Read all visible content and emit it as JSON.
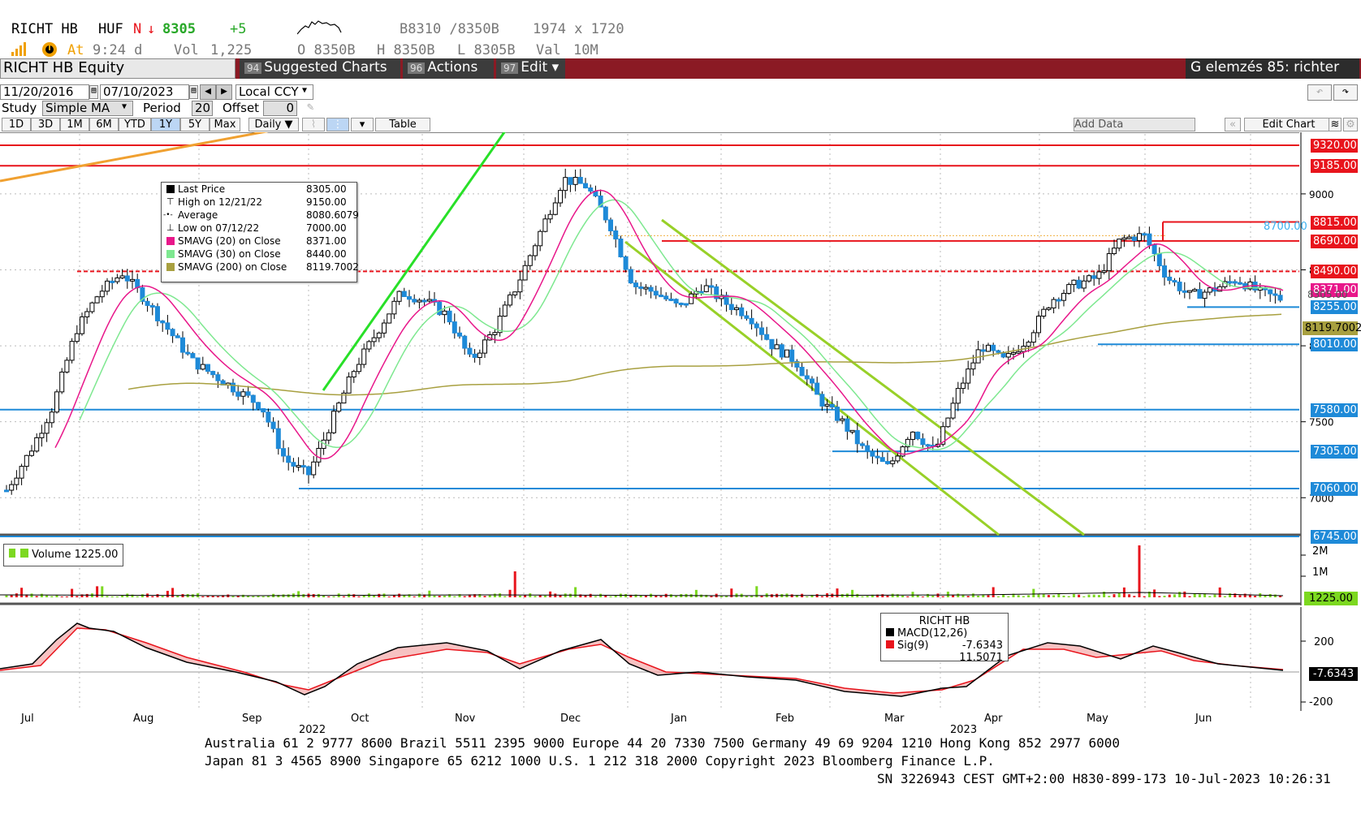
{
  "header": {
    "ticker": "RICHT HB",
    "currency": "HUF",
    "flag": "N",
    "arrow": "↓",
    "last": "8305",
    "change": "+5",
    "bid_ask": "B8310 /8350B",
    "size": "1974 x 1720",
    "at_label": "At",
    "time": "9:24 d",
    "vol_label": "Vol",
    "vol": "1,225",
    "open": "O 8350B",
    "high": "H 8350B",
    "low": "L 8305B",
    "val_label": "Val",
    "val": "10M"
  },
  "toolbar": {
    "equity": "RICHT HB Equity",
    "suggested_num": "94",
    "suggested": "Suggested Charts ▾",
    "actions_num": "96",
    "actions": "Actions ▾",
    "edit_num": "97",
    "edit": "Edit ▾",
    "chart_title": "G elemzés 85: richter"
  },
  "controls": {
    "start_date": "11/20/2016",
    "end_date": "07/10/2023",
    "currency": "Local CCY",
    "study_label": "Study",
    "study": "Simple MA",
    "period_label": "Period",
    "period": "20",
    "offset_label": "Offset",
    "offset": "0",
    "ranges": [
      "1D",
      "3D",
      "1M",
      "6M",
      "YTD",
      "1Y",
      "5Y",
      "Max"
    ],
    "active_range": "1Y",
    "frequency": "Daily ▼",
    "table": "Table",
    "add_data": "Add Data",
    "edit_chart": "Edit Chart"
  },
  "legend": {
    "rows": [
      {
        "label": "Last Price",
        "value": "8305.00",
        "color": "#000000",
        "marker": "box"
      },
      {
        "label": "High on 12/21/22",
        "value": "9150.00",
        "marker": "high"
      },
      {
        "label": "Average",
        "value": "8080.6079",
        "marker": "avg"
      },
      {
        "label": "Low on 07/12/22",
        "value": "7000.00",
        "marker": "low"
      },
      {
        "label": "SMAVG (20)  on Close",
        "value": "8371.00",
        "color": "#e8178a",
        "marker": "box"
      },
      {
        "label": "SMAVG (30)  on Close",
        "value": "8440.00",
        "color": "#7ee890",
        "marker": "box"
      },
      {
        "label": "SMAVG (200)  on Close",
        "value": "8119.7002",
        "color": "#a8a040",
        "marker": "box"
      }
    ]
  },
  "price_labels": [
    {
      "text": "9320.00",
      "color": "#e8141c"
    },
    {
      "text": "9185.00",
      "color": "#e8141c"
    },
    {
      "text": "8815.00",
      "color": "#e8141c"
    },
    {
      "text": "8690.00",
      "color": "#e8141c"
    },
    {
      "text": "8490.00",
      "color": "#e8141c"
    },
    {
      "text": "8371.00",
      "color": "#e8178a"
    },
    {
      "text": "8255.00",
      "color": "#1e8ad8"
    },
    {
      "text": "8119.7002",
      "color": "#a8a040"
    },
    {
      "text": "8010.00",
      "color": "#1e8ad8"
    },
    {
      "text": "7580.00",
      "color": "#1e8ad8"
    },
    {
      "text": "7305.00",
      "color": "#1e8ad8"
    },
    {
      "text": "7060.00",
      "color": "#1e8ad8"
    },
    {
      "text": "6745.00",
      "color": "#1e8ad8"
    }
  ],
  "partial_price_label": "8305.00",
  "annotation_8700": "8700.00",
  "volume": {
    "legend": "Volume 1225.00",
    "last": "1225.00",
    "ticks": [
      "2M",
      "1M"
    ]
  },
  "macd": {
    "title": "RICHT HB",
    "macd_label": "MACD(12,26)",
    "macd_value": "-7.6343",
    "sig_label": "Sig(9)",
    "sig_value": "11.5071",
    "last": "-7.6343",
    "ticks": [
      "200",
      "-200"
    ]
  },
  "x_axis": {
    "months": [
      "Jul",
      "Aug",
      "Sep",
      "Oct",
      "Nov",
      "Dec",
      "Jan",
      "Feb",
      "Mar",
      "Apr",
      "May",
      "Jun"
    ],
    "years": [
      "2022",
      "2023"
    ]
  },
  "chart_data": {
    "type": "candlestick",
    "x_range": [
      "2022-07",
      "2023-07-10"
    ],
    "ylim": [
      6745,
      9320
    ],
    "y_ticks": [
      9000,
      8500,
      8000,
      7500,
      7000
    ],
    "price_levels": [
      9320,
      9185,
      8815,
      8690,
      8490,
      8371,
      8255,
      8119.7002,
      8010,
      7580,
      7305,
      7060,
      6745
    ],
    "last_price": 8305,
    "high": {
      "date": "12/21/22",
      "value": 9150
    },
    "low": {
      "date": "07/12/22",
      "value": 7000
    },
    "average": 8080.6079,
    "close_series": [
      7050,
      7300,
      7600,
      8100,
      8350,
      8480,
      8300,
      8100,
      7900,
      7800,
      7700,
      7600,
      7250,
      7150,
      7500,
      7850,
      8100,
      8350,
      8300,
      8200,
      7900,
      8100,
      8400,
      8750,
      9100,
      9050,
      8800,
      8400,
      8350,
      8250,
      8400,
      8280,
      8200,
      8000,
      7900,
      7650,
      7500,
      7300,
      7200,
      7450,
      7300,
      7700,
      8000,
      7900,
      8050,
      8300,
      8400,
      8450,
      8700,
      8730,
      8450,
      8330,
      8370,
      8440,
      8350,
      8305
    ],
    "sma20_end": 8371,
    "sma30_end": 8440,
    "sma200_end": 8119.7002,
    "volume_last": 1225,
    "macd_last": -7.6343,
    "signal_last": 11.5071
  },
  "footer": {
    "line1": "Australia 61 2 9777 8600 Brazil 5511 2395 9000 Europe 44 20 7330 7500 Germany 49 69 9204 1210 Hong Kong 852 2977 6000",
    "line2": "Japan 81 3 4565 8900       Singapore 65 6212 1000      U.S. 1 212 318 2000        Copyright 2023 Bloomberg Finance L.P.",
    "line3": "SN 3226943 CEST GMT+2:00 H830-899-173 10-Jul-2023 10:26:31"
  }
}
